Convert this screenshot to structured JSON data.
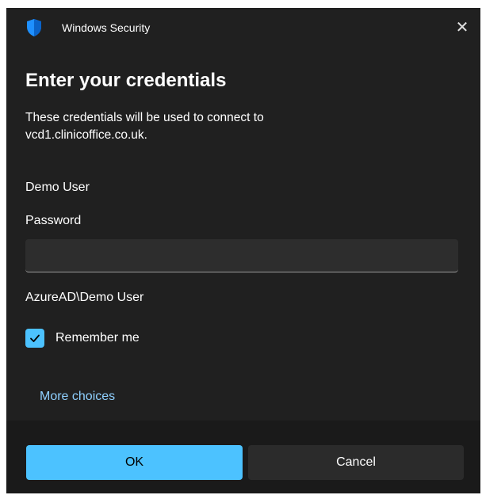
{
  "window": {
    "title": "Windows Security",
    "close_symbol": "✕",
    "icon": "shield-icon"
  },
  "main": {
    "heading": "Enter your credentials",
    "description": "These credentials will be used to connect to vcd1.clinicoffice.co.uk.",
    "user_name": "Demo User",
    "password_label": "Password",
    "password_value": "",
    "password_placeholder": "",
    "domain_user": "AzureAD\\Demo User",
    "remember_label": "Remember me",
    "remember_checked": true,
    "more_choices": "More choices"
  },
  "footer": {
    "ok_label": "OK",
    "cancel_label": "Cancel"
  },
  "colors": {
    "background": "#202020",
    "footer": "#1a1a1a",
    "accent": "#4cc2ff",
    "link": "#8fd0ff",
    "shield": "#1e90ff"
  }
}
